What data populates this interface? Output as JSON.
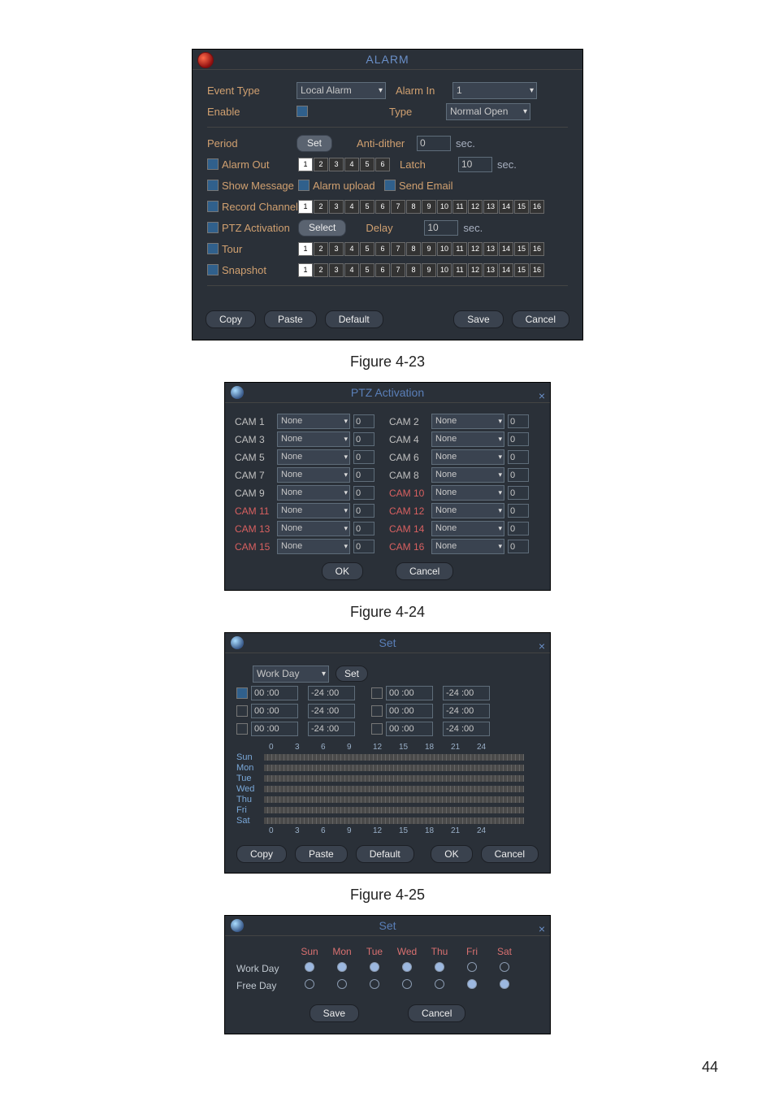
{
  "page_number": "44",
  "figures": {
    "f1": "Figure 4-23",
    "f2": "Figure 4-24",
    "f3": "Figure 4-25"
  },
  "alarm": {
    "title": "ALARM",
    "event_type_label": "Event Type",
    "event_type_value": "Local Alarm",
    "alarm_in_label": "Alarm In",
    "alarm_in_value": "1",
    "enable_label": "Enable",
    "type_label": "Type",
    "type_value": "Normal Open",
    "period_label": "Period",
    "set_btn": "Set",
    "anti_dither_label": "Anti-dither",
    "anti_dither_value": "0",
    "sec": "sec.",
    "alarm_out_label": "Alarm Out",
    "latch_label": "Latch",
    "latch_value": "10",
    "show_message_label": "Show Message",
    "alarm_upload_label": "Alarm upload",
    "send_email_label": "Send Email",
    "record_channel_label": "Record Channel",
    "ptz_activation_label": "PTZ Activation",
    "select_btn": "Select",
    "delay_label": "Delay",
    "delay_value": "10",
    "tour_label": "Tour",
    "snapshot_label": "Snapshot",
    "footer": {
      "copy": "Copy",
      "paste": "Paste",
      "default": "Default",
      "save": "Save",
      "cancel": "Cancel"
    },
    "channels6": [
      "1",
      "2",
      "3",
      "4",
      "5",
      "6"
    ],
    "channels16": [
      "1",
      "2",
      "3",
      "4",
      "5",
      "6",
      "7",
      "8",
      "9",
      "10",
      "11",
      "12",
      "13",
      "14",
      "15",
      "16"
    ]
  },
  "ptz": {
    "title": "PTZ Activation",
    "ok": "OK",
    "cancel": "Cancel",
    "none": "None",
    "zero": "0",
    "left": [
      {
        "n": "CAM 1",
        "c": ""
      },
      {
        "n": "CAM 3",
        "c": ""
      },
      {
        "n": "CAM 5",
        "c": ""
      },
      {
        "n": "CAM 7",
        "c": ""
      },
      {
        "n": "CAM 9",
        "c": ""
      },
      {
        "n": "CAM 11",
        "c": "red"
      },
      {
        "n": "CAM 13",
        "c": "red"
      },
      {
        "n": "CAM 15",
        "c": "red"
      }
    ],
    "right": [
      {
        "n": "CAM 2",
        "c": ""
      },
      {
        "n": "CAM 4",
        "c": ""
      },
      {
        "n": "CAM 6",
        "c": ""
      },
      {
        "n": "CAM 8",
        "c": ""
      },
      {
        "n": "CAM 10",
        "c": "red"
      },
      {
        "n": "CAM 12",
        "c": "red"
      },
      {
        "n": "CAM 14",
        "c": "red"
      },
      {
        "n": "CAM 16",
        "c": "red"
      }
    ]
  },
  "setsched": {
    "title": "Set",
    "workday": "Work Day",
    "set_btn": "Set",
    "slots": [
      {
        "s": "00 :00",
        "e": "-24 :00"
      },
      {
        "s": "00 :00",
        "e": "-24 :00"
      },
      {
        "s": "00 :00",
        "e": "-24 :00"
      },
      {
        "s": "00 :00",
        "e": "-24 :00"
      },
      {
        "s": "00 :00",
        "e": "-24 :00"
      },
      {
        "s": "00 :00",
        "e": "-24 :00"
      }
    ],
    "hours": [
      "0",
      "3",
      "6",
      "9",
      "12",
      "15",
      "18",
      "21",
      "24"
    ],
    "days": [
      "Sun",
      "Mon",
      "Tue",
      "Wed",
      "Thu",
      "Fri",
      "Sat"
    ],
    "footer": {
      "copy": "Copy",
      "paste": "Paste",
      "default": "Default",
      "ok": "OK",
      "cancel": "Cancel"
    }
  },
  "setdays": {
    "title": "Set",
    "days": [
      "Sun",
      "Mon",
      "Tue",
      "Wed",
      "Thu",
      "Fri",
      "Sat"
    ],
    "workday_label": "Work Day",
    "freeday_label": "Free Day",
    "work": [
      true,
      true,
      true,
      true,
      true,
      false,
      false
    ],
    "free": [
      false,
      false,
      false,
      false,
      false,
      true,
      true
    ],
    "save": "Save",
    "cancel": "Cancel"
  }
}
